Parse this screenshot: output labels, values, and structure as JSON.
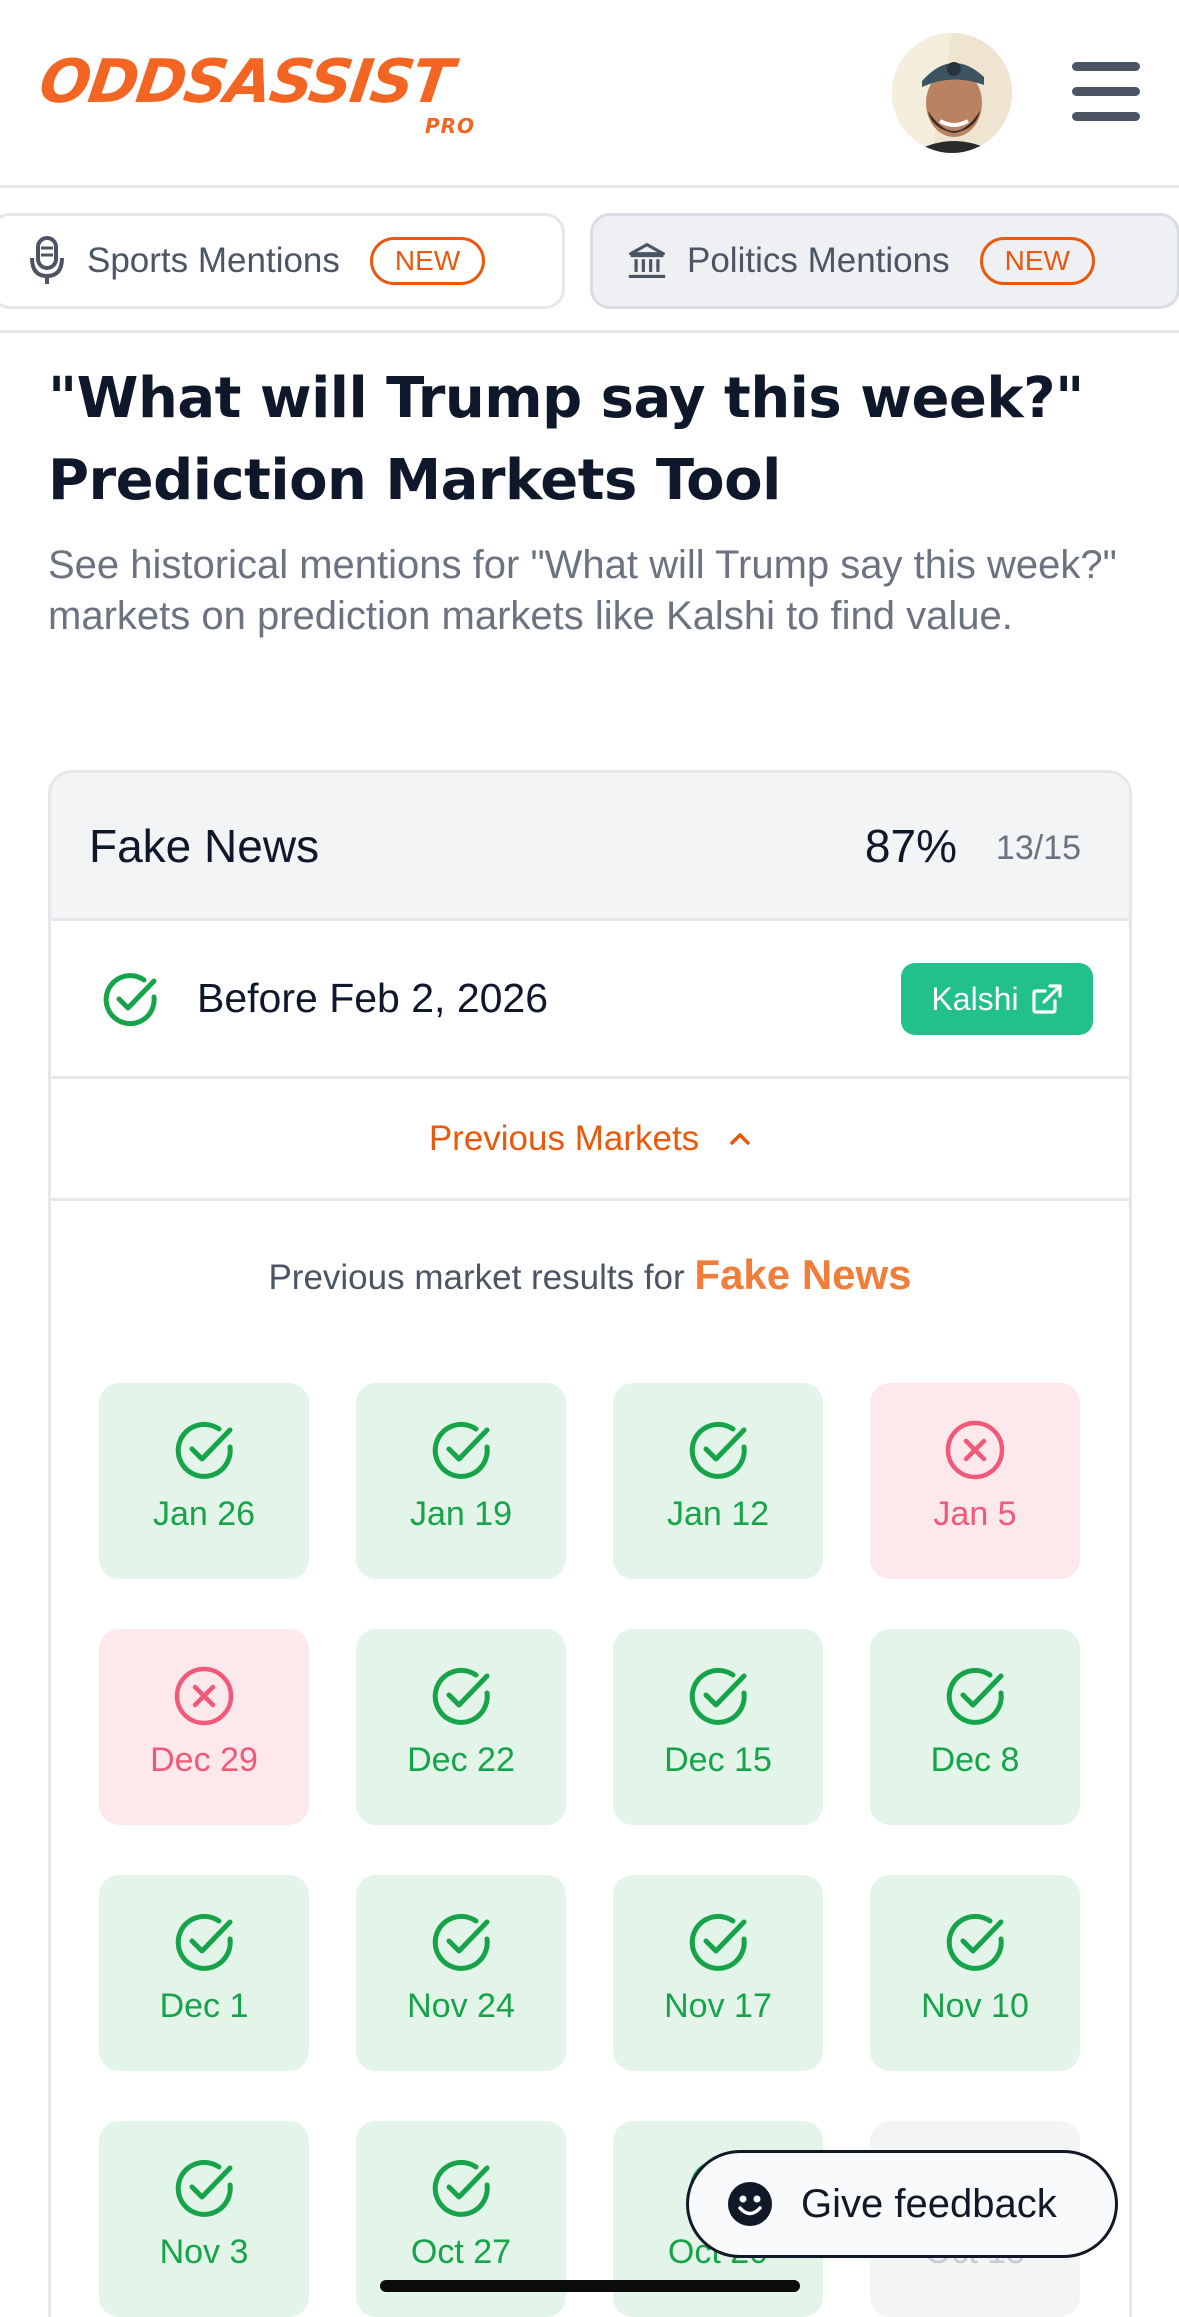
{
  "header": {
    "logo_text": "ODDSASSIST",
    "logo_sub": "PRO",
    "avatar_icon": "user-avatar",
    "menu_icon": "hamburger-menu-icon"
  },
  "tabs": [
    {
      "label": "Sports Mentions",
      "badge": "NEW",
      "icon": "microphone-icon"
    },
    {
      "label": "Politics Mentions",
      "badge": "NEW",
      "icon": "government-building-icon"
    }
  ],
  "page": {
    "title_line1": "\"What will Trump say this week?\"",
    "title_line2": "Prediction Markets Tool",
    "subtitle": "See historical mentions for \"What will Trump say this week?\" markets on prediction markets like Kalshi to find value."
  },
  "card": {
    "title": "Fake News",
    "percent": "87%",
    "fraction": "13/15",
    "market": {
      "status_icon": "check-circle-icon",
      "label": "Before Feb 2, 2026",
      "link_label": "Kalshi",
      "link_icon": "external-link-icon"
    },
    "previous_toggle": "Previous Markets",
    "results_prefix": "Previous market results for",
    "results_term": "Fake News",
    "results": [
      {
        "date": "Jan 26",
        "status": "win"
      },
      {
        "date": "Jan 19",
        "status": "win"
      },
      {
        "date": "Jan 12",
        "status": "win"
      },
      {
        "date": "Jan 5",
        "status": "loss"
      },
      {
        "date": "Dec 29",
        "status": "loss"
      },
      {
        "date": "Dec 22",
        "status": "win"
      },
      {
        "date": "Dec 15",
        "status": "win"
      },
      {
        "date": "Dec 8",
        "status": "win"
      },
      {
        "date": "Dec 1",
        "status": "win"
      },
      {
        "date": "Nov 24",
        "status": "win"
      },
      {
        "date": "Nov 17",
        "status": "win"
      },
      {
        "date": "Nov 10",
        "status": "win"
      },
      {
        "date": "Nov 3",
        "status": "win"
      },
      {
        "date": "Oct 27",
        "status": "win"
      },
      {
        "date": "Oct 20",
        "status": "win"
      },
      {
        "date": "Oct 13",
        "status": "pending"
      }
    ]
  },
  "feedback": {
    "label": "Give feedback",
    "icon": "smiley-icon"
  },
  "colors": {
    "brand": "#f26522",
    "success": "#16a34a",
    "danger": "#f05a78",
    "kalshi": "#22c08a"
  }
}
